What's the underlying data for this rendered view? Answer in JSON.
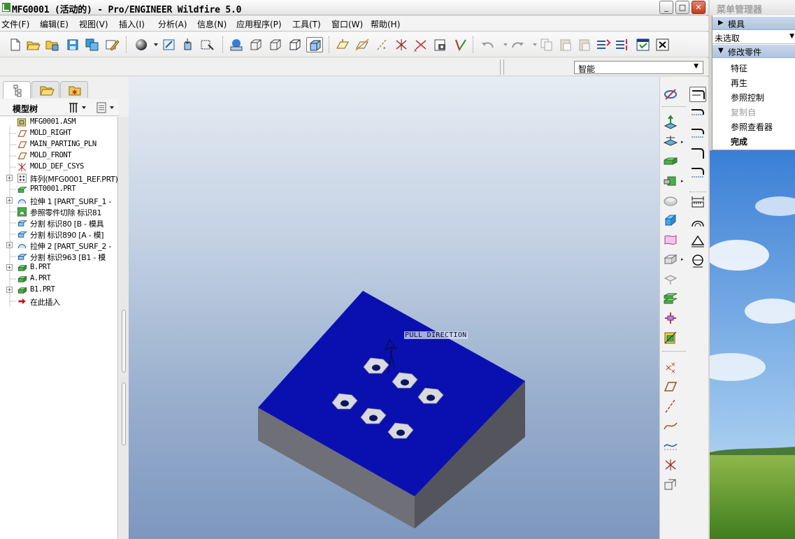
{
  "window": {
    "title": "MFG0001 (活动的) - Pro/ENGINEER Wildfire 5.0",
    "minimize": "_",
    "maximize": "□",
    "close": "✕"
  },
  "menu_bar": [
    "文件(F)",
    "编辑(E)",
    "视图(V)",
    "插入(I)",
    "分析(A)",
    "信息(N)",
    "应用程序(P)",
    "工具(T)",
    "窗口(W)",
    "帮助(H)"
  ],
  "toolbar": {
    "icons": [
      "new-file-icon",
      "open-file-icon",
      "open-folder-icon",
      "save-icon",
      "save-copy-icon",
      "edit-icon",
      "render-sphere-icon",
      "dropdown-arrow-icon",
      "repaint-icon",
      "spin-center-icon",
      "zoom-box-icon",
      "pick-icon",
      "wireframe-icon",
      "hidden-line-icon",
      "no-hidden-icon",
      "shading-icon",
      "datum-plane-display-icon",
      "datum-axis-display-icon",
      "datum-point-display-icon",
      "csys-display-icon",
      "named-view-icon",
      "annotation-icon",
      "undo-icon",
      "redo-icon",
      "copy-icon",
      "paste-icon",
      "paste-special-icon",
      "regenerate-icon",
      "regen-manager-icon",
      "window-activate-icon",
      "window-close-icon"
    ]
  },
  "filter": {
    "value": "智能",
    "arrow": "▼"
  },
  "navigator": {
    "tab_icons": [
      "model-tree-tab-icon",
      "folder-browser-tab-icon",
      "favorites-tab-icon"
    ],
    "model_tree_title": "模型树"
  },
  "model_tree": [
    {
      "label": "MFG0001.ASM",
      "icon": "assembly-icon",
      "expander": ""
    },
    {
      "label": "MOLD_RIGHT",
      "icon": "datum-plane-icon",
      "expander": ""
    },
    {
      "label": "MAIN_PARTING_PLN",
      "icon": "datum-plane-icon",
      "expander": ""
    },
    {
      "label": "MOLD_FRONT",
      "icon": "datum-plane-icon",
      "expander": ""
    },
    {
      "label": "MOLD_DEF_CSYS",
      "icon": "csys-icon",
      "expander": ""
    },
    {
      "label": "阵列(MFG0001_REF.PRT)",
      "icon": "pattern-icon",
      "expander": "+"
    },
    {
      "label": "PRT0001.PRT",
      "icon": "part-icon",
      "expander": ""
    },
    {
      "label": "拉伸 1 [PART_SURF_1 - ",
      "icon": "extrude-surface-icon",
      "expander": "+"
    },
    {
      "label": "参照零件切除 标识81",
      "icon": "ref-part-cutout-icon",
      "expander": ""
    },
    {
      "label": "分割 标识80 [B - 模具",
      "icon": "split-volume-icon",
      "expander": ""
    },
    {
      "label": "分割 标识890 [A - 模]",
      "icon": "split-volume-icon",
      "expander": ""
    },
    {
      "label": "拉伸 2 [PART_SURF_2 - ",
      "icon": "extrude-surface-icon",
      "expander": "+"
    },
    {
      "label": "分割 标识963 [B1 - 模",
      "icon": "split-volume-icon",
      "expander": ""
    },
    {
      "label": "B.PRT",
      "icon": "mold-component-icon",
      "expander": "+"
    },
    {
      "label": "A.PRT",
      "icon": "mold-component-icon",
      "expander": ""
    },
    {
      "label": "B1.PRT",
      "icon": "mold-component-icon",
      "expander": "+"
    },
    {
      "label": "在此插入",
      "icon": "insert-here-arrow-icon",
      "expander": ""
    }
  ],
  "graphics": {
    "pull_direction_label": "PULL DIRECTION",
    "model_colors": {
      "top": "#0a10b0",
      "side_left": "#6f6f77",
      "side_front": "#54545c",
      "hole_face": "#d8dae0",
      "hole": "#0b1660"
    }
  },
  "right_toolbar_1": [
    "hide-icon",
    "pull-direction-icon",
    "reference-model-icon",
    "workpiece-icon",
    "mold-component-icon",
    "shrinkage-icon",
    "volume-split-icon",
    "parting-surface-icon",
    "silhouette-curve-icon",
    "skirt-surface-icon",
    "cavity-insert-icon",
    "mold-layout-icon",
    "mold-opening-icon",
    "draft-check-icon",
    "datum-point-icon",
    "datum-plane-icon",
    "datum-axis-icon",
    "sketched-curve-icon",
    "curve-icon",
    "csys-icon",
    "analysis-feature-icon"
  ],
  "right_toolbar_2": [
    "runner-icon",
    "water-line-icon",
    "ejector-pin-icon",
    "sprue-icon",
    "gate-icon",
    "measure-icon",
    "thickness-check-icon",
    "projected-area-icon",
    "draft-angle-icon"
  ],
  "menu_manager": {
    "title": "菜单管理器",
    "section_mold": "模具",
    "selection_value": "未选取",
    "section_modify": "修改零件",
    "items": [
      {
        "label": "特征",
        "enabled": true
      },
      {
        "label": "再生",
        "enabled": true
      },
      {
        "label": "参照控制",
        "enabled": true
      },
      {
        "label": "复制自",
        "enabled": false
      },
      {
        "label": "参照查看器",
        "enabled": true
      },
      {
        "label": "完成",
        "enabled": true
      }
    ],
    "background": "meadow-and-sky-desktop-wallpaper"
  }
}
